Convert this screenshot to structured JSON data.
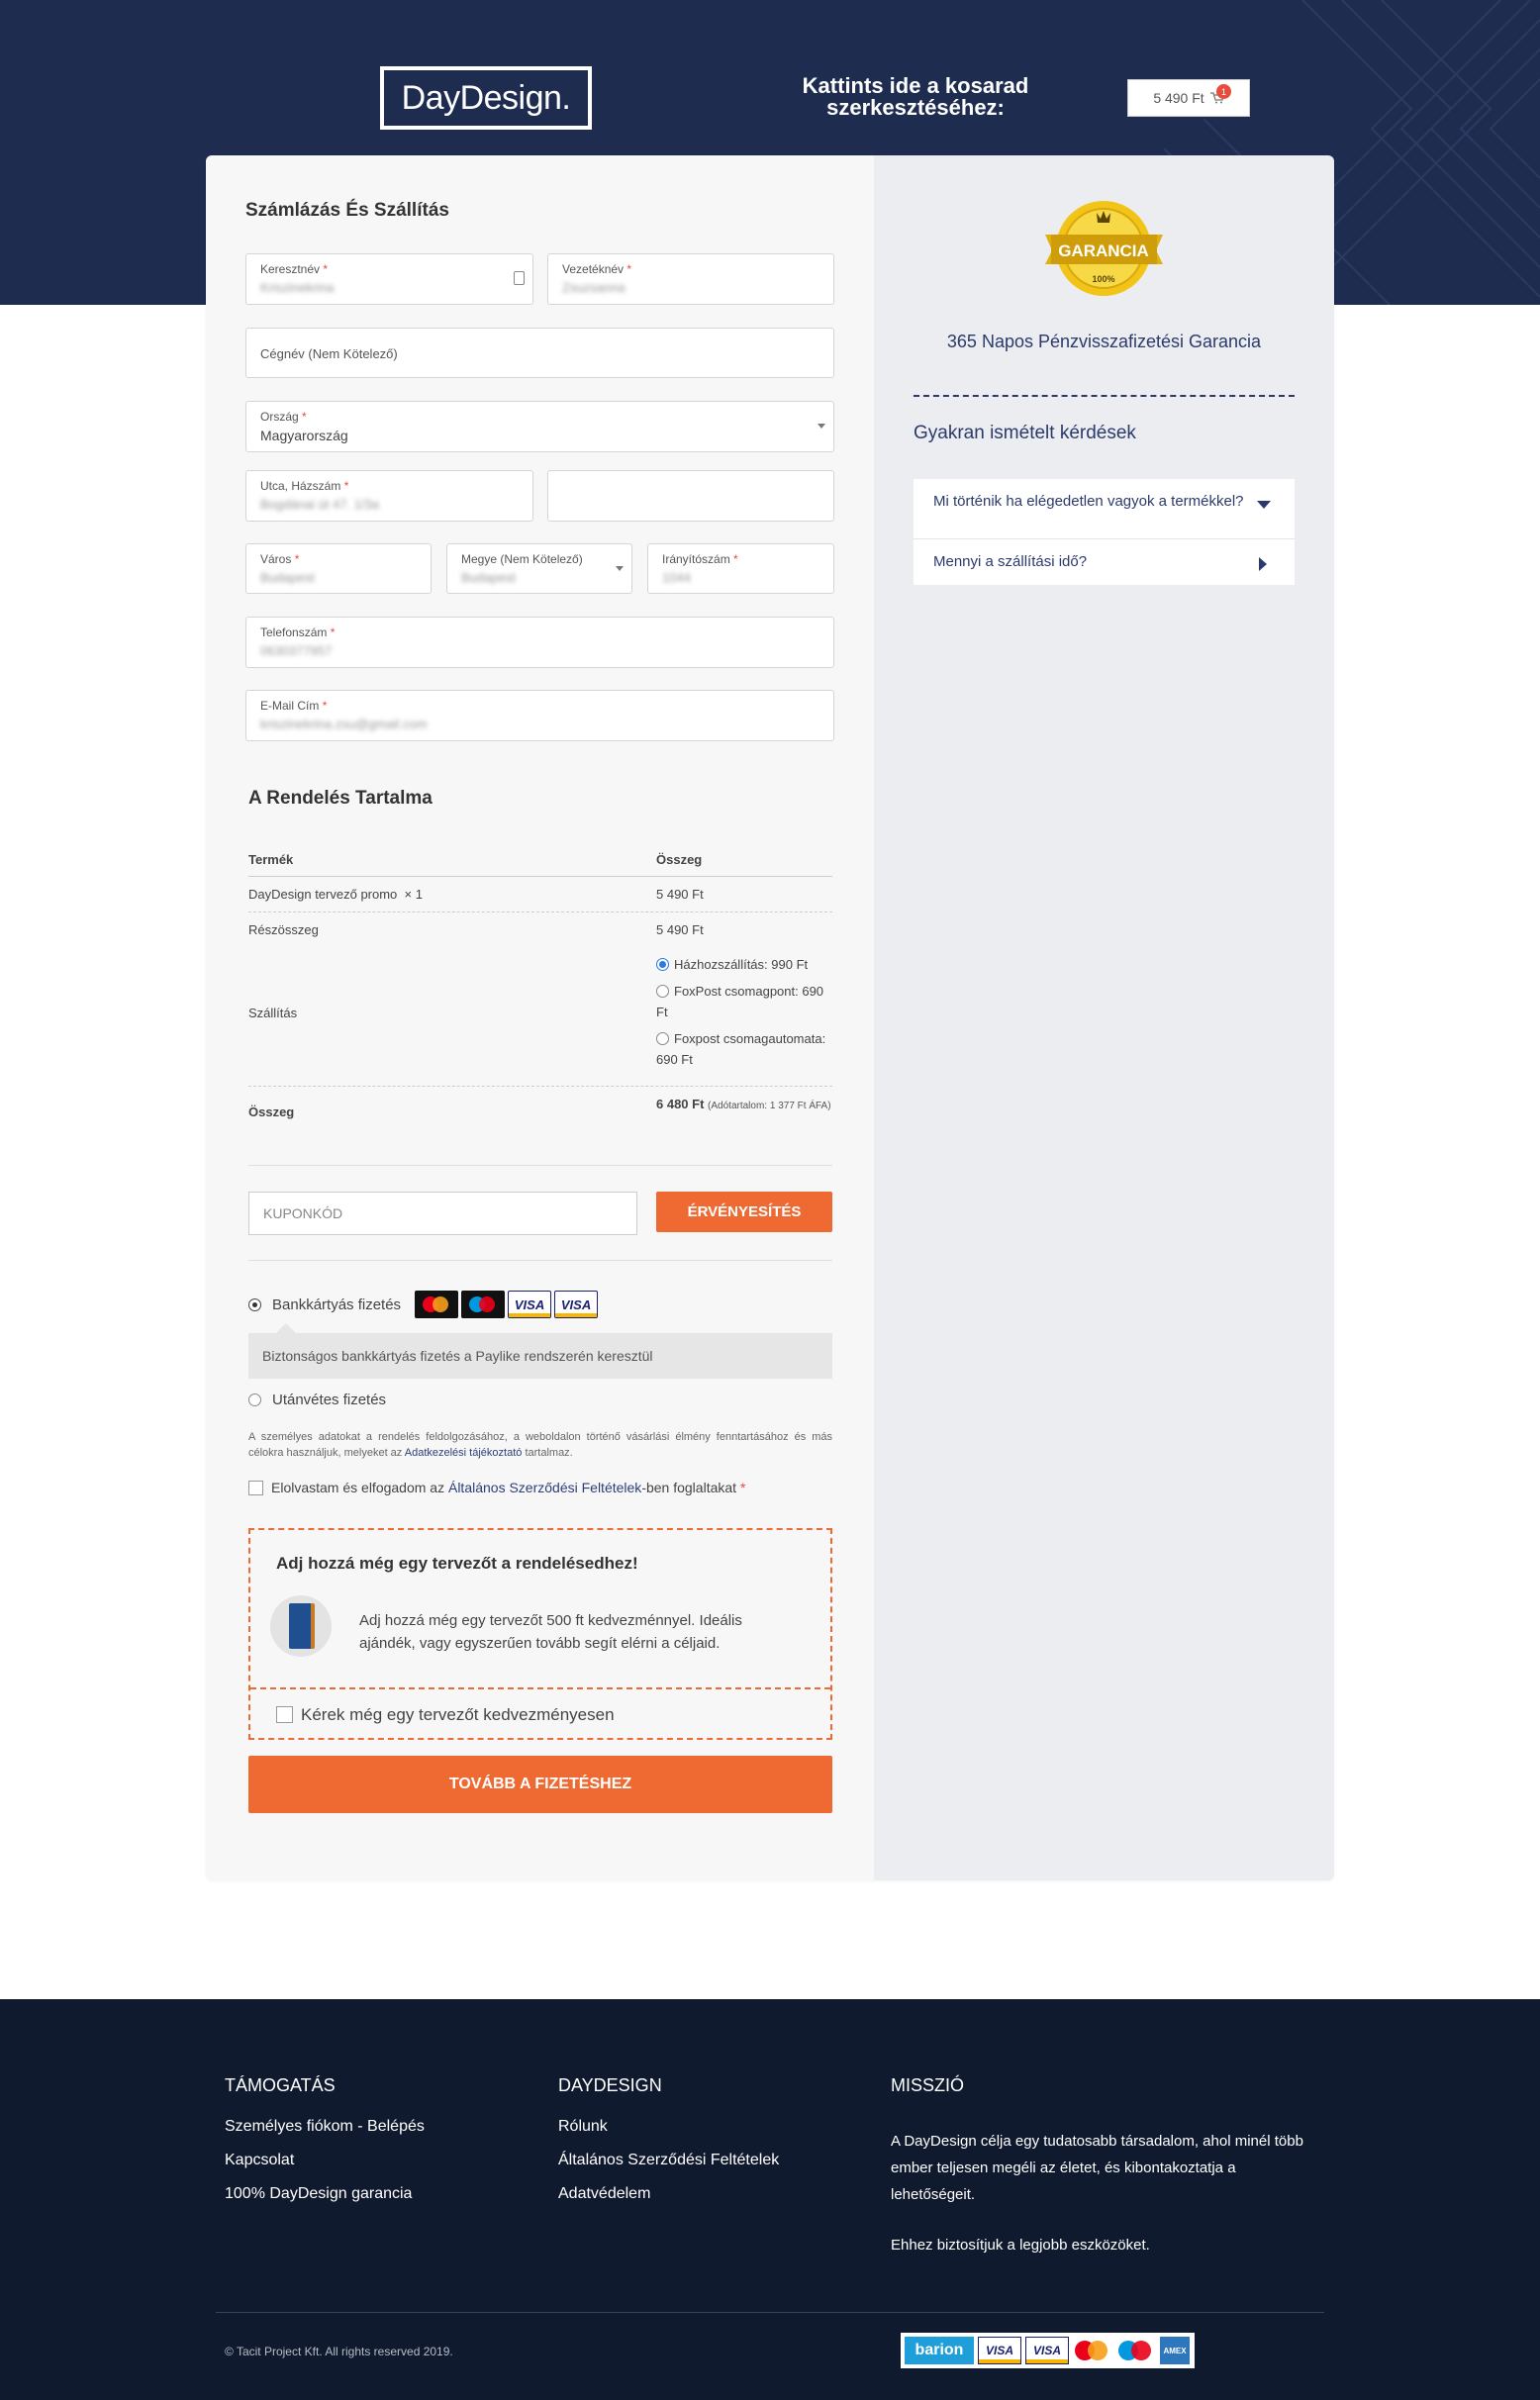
{
  "header": {
    "logo_text": "DayDesign.",
    "cart_cta": "Kattints ide a kosarad szerkesztéséhez:",
    "cart_total": "5 490 Ft",
    "cart_count": "1",
    "background_color": "#1d2c4f"
  },
  "billing": {
    "title": "Számlázás És Szállítás",
    "fields": {
      "first_name": {
        "label": "Keresztnév",
        "value": "Kriszinekrina"
      },
      "last_name": {
        "label": "Vezetéknév",
        "value": "Zsuzsanna"
      },
      "company": {
        "placeholder": "Cégnév (Nem Kötelező)"
      },
      "country": {
        "label": "Ország",
        "value": "Magyarország"
      },
      "street": {
        "label": "Utca, Házszám",
        "value": "Bogdánai út 47. 1/3a"
      },
      "city": {
        "label": "Város",
        "value": "Budapest"
      },
      "county": {
        "label": "Megye (Nem Kötelező)",
        "value": "Budapest"
      },
      "zip": {
        "label": "Irányítószám",
        "value": "1044"
      },
      "phone": {
        "label": "Telefonszám",
        "value": "0630377957"
      },
      "email": {
        "label": "E-Mail Cím",
        "value": "kriszinekrina.zsu@gmail.com"
      }
    },
    "required_mark": "*"
  },
  "order": {
    "title": "A Rendelés Tartalma",
    "col_product": "Termék",
    "col_total": "Összeg",
    "item_name": "DayDesign tervező promo",
    "item_qty": "× 1",
    "item_price": "5 490 Ft",
    "subtotal_label": "Részösszeg",
    "subtotal_value": "5 490 Ft",
    "shipping_label": "Szállítás",
    "shipping_options": [
      {
        "label": "Házhozszállítás: 990 Ft",
        "selected": true
      },
      {
        "label": "FoxPost csomagpont: 690 Ft",
        "selected": false
      },
      {
        "label": "Foxpost csomagautomata: 690 Ft",
        "selected": false
      }
    ],
    "total_label": "Összeg",
    "total_value": "6 480 Ft",
    "tax_note": "(Adótartalom: 1 377 Ft ÁFA)"
  },
  "coupon": {
    "placeholder": "KUPONKÓD",
    "button": "ÉRVÉNYESÍTÉS"
  },
  "payment": {
    "card_option": "Bankkártyás fizetés",
    "card_description": "Biztonságos bankkártyás fizetés a Paylike rendszerén keresztül",
    "cod_option": "Utánvétes fizetés",
    "card_logos": [
      "mastercard",
      "maestro",
      "VISA",
      "VISA"
    ],
    "privacy_text_a": "A személyes adatokat a rendelés feldolgozásához, a weboldalon történő vásárlási élmény fenntartásához és más célokra használjuk, melyeket az ",
    "privacy_link": "Adatkezelési tájékoztató",
    "privacy_text_b": " tartalmaz.",
    "terms_a": "Elolvastam és elfogadom az ",
    "terms_link": "Általános Szerződési Feltételek",
    "terms_b": "-ben foglaltakat",
    "terms_required": "*"
  },
  "upsell": {
    "title": "Adj hozzá még egy tervezőt a rendelésedhez!",
    "text": "Adj hozzá még egy tervezőt 500 ft kedvezménnyel. Ideális ajándék, vagy egyszerűen tovább segít elérni a céljaid.",
    "checkbox_label": "Kérek még egy tervezőt kedvezményesen"
  },
  "submit_button": "TOVÁBB A FIZETÉSHEZ",
  "accent_color": "#ef6a32",
  "sidebar": {
    "badge_text": "GARANCIA",
    "badge_percent": "100%",
    "badge_ring": "ELÉGEDETTSÉGI",
    "guarantee": "365 Napos Pénzvisszafizetési Garancia",
    "faq_title": "Gyakran ismételt kérdések",
    "faq": [
      {
        "q": "Mi történik ha elégedetlen vagyok a termékkel?",
        "expanded": true
      },
      {
        "q": "Mennyi a szállítási idő?",
        "expanded": false
      }
    ]
  },
  "footer": {
    "support_title": "TÁMOGATÁS",
    "support_links": [
      "Személyes fiókom - Belépés",
      "Kapcsolat",
      "100% DayDesign garancia"
    ],
    "daydesign_title": "DAYDESIGN",
    "daydesign_links": [
      "Rólunk",
      "Általános Szerződési Feltételek",
      "Adatvédelem"
    ],
    "mission_title": "MISSZIÓ",
    "mission_text_1": "A DayDesign célja egy tudatosabb társadalom, ahol minél több ember teljesen megéli az életet, és kibontakoztatja a lehetőségeit.",
    "mission_text_2": "Ehhez biztosítjuk a legjobb eszközöket.",
    "copyright": "© Tacit Project Kft. All rights reserved 2019.",
    "payment_logos": [
      "barion",
      "VISA",
      "VISA",
      "mastercard",
      "maestro",
      "AMEX"
    ]
  }
}
